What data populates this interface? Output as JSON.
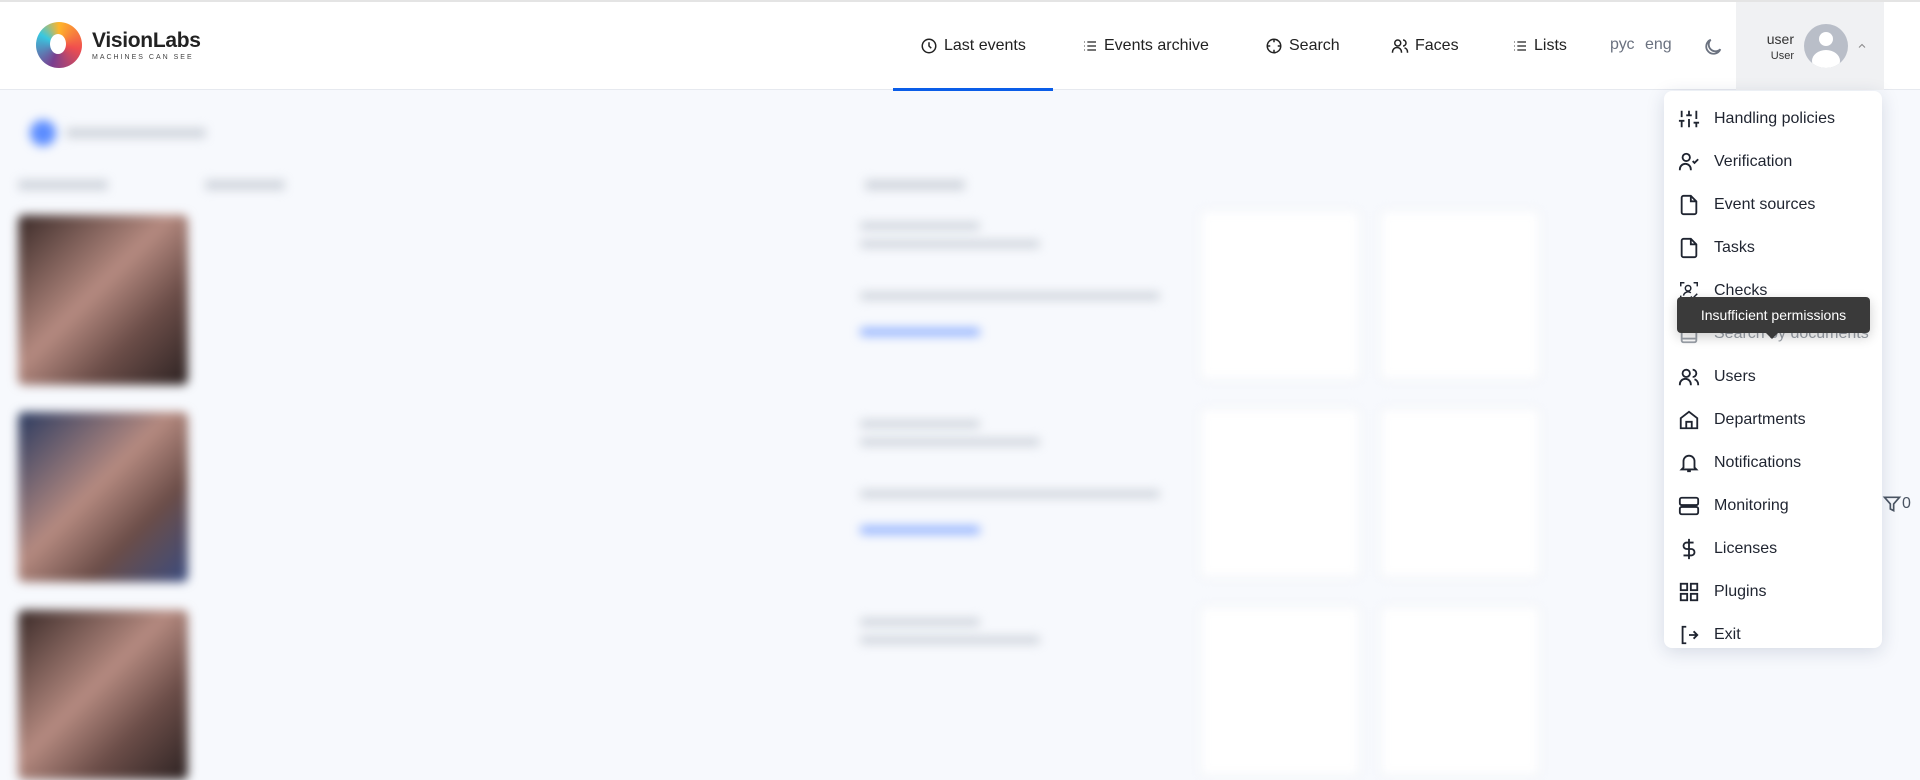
{
  "brand": {
    "name": "VisionLabs",
    "tagline": "MACHINES CAN SEE"
  },
  "nav": {
    "items": [
      {
        "label": "Last events",
        "icon": "clock-icon",
        "active": true
      },
      {
        "label": "Events archive",
        "icon": "list-icon"
      },
      {
        "label": "Search",
        "icon": "crosshair-icon"
      },
      {
        "label": "Faces",
        "icon": "users-icon"
      },
      {
        "label": "Lists",
        "icon": "list-icon"
      }
    ]
  },
  "lang": {
    "ru": "рус",
    "en": "eng"
  },
  "user": {
    "login": "user",
    "role": "User"
  },
  "menu": {
    "items": [
      {
        "label": "Handling policies",
        "icon": "sliders-icon"
      },
      {
        "label": "Verification",
        "icon": "user-check-icon"
      },
      {
        "label": "Event sources",
        "icon": "file-icon"
      },
      {
        "label": "Tasks",
        "icon": "file-icon"
      },
      {
        "label": "Checks",
        "icon": "face-check-icon"
      },
      {
        "label": "Search by documents",
        "icon": "document-icon",
        "disabled": true
      },
      {
        "label": "Users",
        "icon": "users-icon"
      },
      {
        "label": "Departments",
        "icon": "home-icon"
      },
      {
        "label": "Notifications",
        "icon": "bell-icon"
      },
      {
        "label": "Monitoring",
        "icon": "server-icon"
      },
      {
        "label": "Licenses",
        "icon": "dollar-icon"
      },
      {
        "label": "Plugins",
        "icon": "grid-icon"
      },
      {
        "label": "Exit",
        "icon": "logout-icon"
      }
    ]
  },
  "tooltip": "Insufficient permissions",
  "filter": {
    "count": "0"
  },
  "colors": {
    "accent": "#0a5de8",
    "tooltip": "#3a3a3a"
  }
}
